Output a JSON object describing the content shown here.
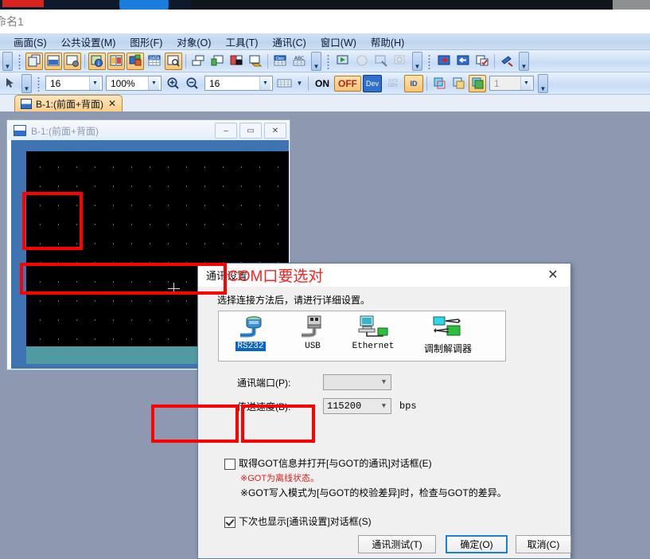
{
  "app": {
    "title": "命名1"
  },
  "menubar": {
    "items": [
      {
        "label": "画面(S)",
        "name": "menu-screen"
      },
      {
        "label": "公共设置(M)",
        "name": "menu-common"
      },
      {
        "label": "图形(F)",
        "name": "menu-figure"
      },
      {
        "label": "对象(O)",
        "name": "menu-object"
      },
      {
        "label": "工具(T)",
        "name": "menu-tool"
      },
      {
        "label": "通讯(C)",
        "name": "menu-communication"
      },
      {
        "label": "窗口(W)",
        "name": "menu-window"
      },
      {
        "label": "帮助(H)",
        "name": "menu-help"
      }
    ]
  },
  "toolbar2": {
    "font_size": "16",
    "zoom_level": "100%",
    "grid_size": "16",
    "on_label": "ON",
    "off_label": "OFF",
    "dev_label": "Dev",
    "sysdev_label": "SYS DEV",
    "id_label": "ID",
    "layer_value": "1"
  },
  "tab": {
    "label": "B-1:(前面+背面)",
    "close": "✕"
  },
  "mdi": {
    "title": "B-1:(前面+背面)",
    "minimize": "–",
    "restore": "▭",
    "close": "✕"
  },
  "dialog": {
    "title": "通讯设置",
    "close": "✕",
    "hint": "选择连接方法后，请进行详细设置。",
    "connection_methods": [
      {
        "label": "RS232",
        "name": "conn-rs232",
        "selected": true
      },
      {
        "label": "USB",
        "name": "conn-usb",
        "selected": false
      },
      {
        "label": "Ethernet",
        "name": "conn-ethernet",
        "selected": false
      },
      {
        "label": "调制解调器",
        "name": "conn-modem",
        "selected": false
      }
    ],
    "port_label": "通讯端口(P):",
    "port_value": "",
    "speed_label": "传送速度(B):",
    "speed_value": "115200",
    "speed_unit": "bps",
    "checkbox_got": {
      "label": "取得GOT信息并打开[与GOT的通讯]对话框(E)",
      "checked": false,
      "note_red": "※GOT为离线状态。",
      "note_black": "※GOT写入模式为[与GOT的校验差异]时，检查与GOT的差异。"
    },
    "checkbox_show_next": {
      "label": "下次也显示[通讯设置]对话框(S)",
      "checked": true
    },
    "buttons": {
      "test": "通讯测试(T)",
      "ok": "确定(O)",
      "cancel": "取消(C)"
    }
  },
  "annotation": {
    "com_note": "COM口要选对",
    "color": "#ff0000"
  }
}
